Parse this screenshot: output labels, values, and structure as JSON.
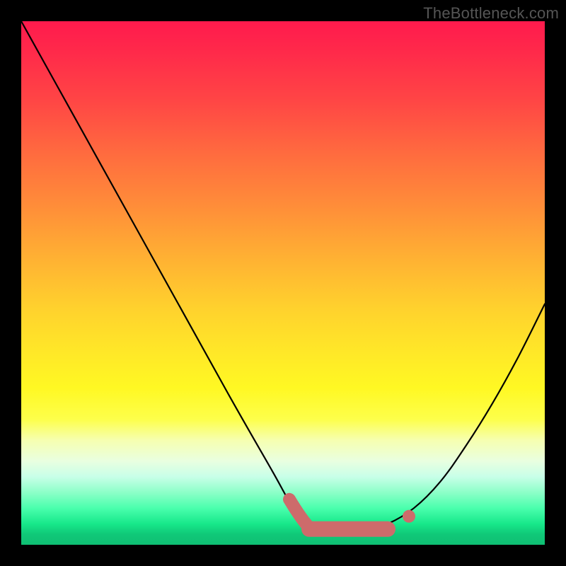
{
  "watermark": "TheBottleneck.com",
  "chart_data": {
    "type": "line",
    "title": "",
    "xlabel": "",
    "ylabel": "",
    "xlim": [
      0,
      100
    ],
    "ylim": [
      0,
      100
    ],
    "grid": false,
    "series": [
      {
        "name": "bottleneck-curve",
        "x": [
          0,
          10,
          20,
          30,
          40,
          48,
          52,
          55,
          58,
          62,
          66,
          70,
          75,
          80,
          85,
          90,
          95,
          100
        ],
        "y": [
          100,
          82,
          64,
          46,
          28,
          14,
          7,
          4,
          3,
          3,
          3,
          4,
          7,
          12,
          19,
          27,
          36,
          46
        ],
        "color": "#000000"
      }
    ],
    "annotations": [
      {
        "name": "valley-fit-band",
        "shape": "rounded-band",
        "x_range": [
          55,
          70
        ],
        "y": 3,
        "color": "#cd6b6b"
      }
    ]
  },
  "colors": {
    "frame": "#000000",
    "curve": "#000000",
    "fit_band": "#cd6b6b"
  }
}
